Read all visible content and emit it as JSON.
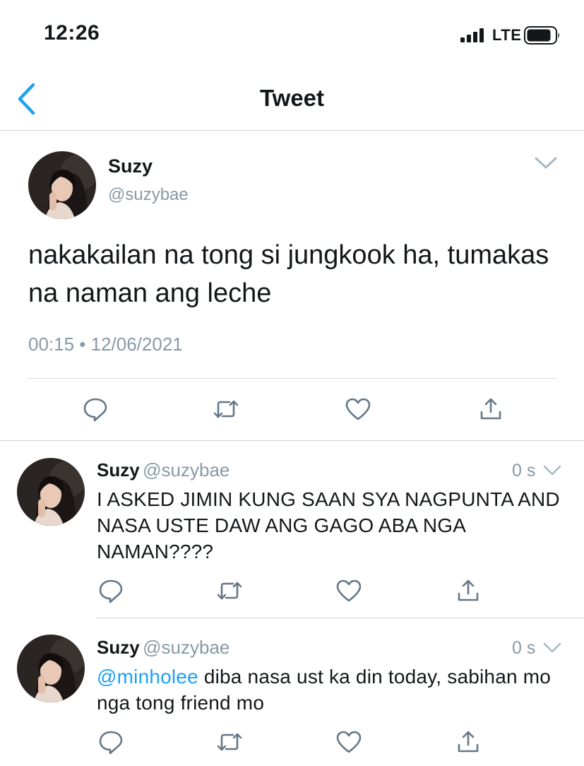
{
  "status_bar": {
    "time": "12:26",
    "network": "LTE",
    "icons": [
      "signal-icon",
      "battery-icon"
    ]
  },
  "nav": {
    "title": "Tweet",
    "back_icon": "chevron-left-icon"
  },
  "colors": {
    "accent": "#1da1f2",
    "text": "#14171a",
    "secondary": "#8899a6",
    "divider": "#cfd4d9"
  },
  "main_tweet": {
    "name": "Suzy",
    "handle": "@suzybae",
    "text": "nakakailan na tong si jungkook ha, tumakas na naman ang leche",
    "timestamp": "00:15 • 12/06/2021",
    "actions": [
      "reply-icon",
      "retweet-icon",
      "like-icon",
      "share-icon"
    ]
  },
  "replies": [
    {
      "name": "Suzy",
      "handle": "@suzybae",
      "time": "0 s",
      "text": "I ASKED JIMIN KUNG SAAN SYA NAGPUNTA AND NASA USTE DAW ANG GAGO ABA NGA NAMAN????"
    },
    {
      "name": "Suzy",
      "handle": "@suzybae",
      "time": "0 s",
      "mention": "@minholee",
      "text": " diba nasa ust ka din today, sabihan mo nga tong friend mo"
    }
  ]
}
